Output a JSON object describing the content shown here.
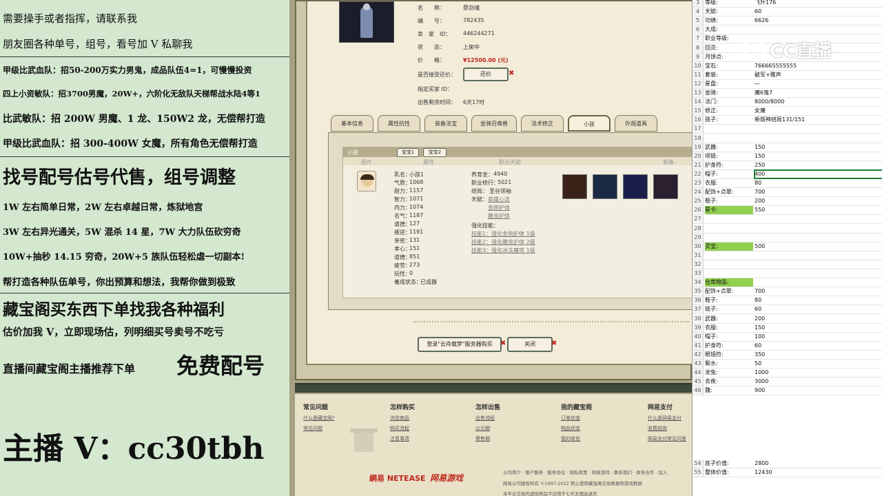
{
  "left_overlay": {
    "lines": [
      "需要操手或者指挥，请联系我",
      "朋友圈各种单号，组号，看号加 V 私聊我",
      "甲级比武血队：招50-200万实力男鬼，成品队伍4=1，可慢慢投资",
      "四上小资敏队：招3700男魔，20W+，六阶化无敌队天梯帮战水陆4等1",
      "比武敏队：招 200W 男魔、1 龙、150W2 龙，无偿帮打造",
      "甲级比武血队：招 300-400W 女魔，所有角色无偿帮打造",
      "找号配号估号代售，组号调整",
      "1W 左右简单日常，2W 左右卓越日常，炼狱地宫",
      "3W 左右异光通关，5W 混杀 14 星，7W 大力队伍砍穷奇",
      "10W+抽秒 14.15 穷奇，20W+5 族队伍轻松虐一切副本!",
      "帮打造各种队伍单号，你出预算和想法，我帮你做到极致",
      "藏宝阁买东西下单找我各种福利",
      "估价加我 V，立即现场估，列明细买号卖号不吃亏",
      "直播间藏宝阁主播推荐下单",
      "免费配号",
      "主播 V：cc30tbh"
    ]
  },
  "listing": {
    "name_label": "名　　称：",
    "name_value": "祭剑魂",
    "id_label": "编　　号：",
    "id_value": "782435",
    "seller_label": "卖　家　ID：",
    "seller_value": "446244271",
    "status_label": "状　　态：",
    "status_value": "上架中",
    "price_label": "价　　格：",
    "price_value": "¥12500.00 (元)",
    "bargain_label": "是否接受还价：",
    "bargain_button": "还价",
    "buyer_label": "指定买家 ID：",
    "remaining_label": "出售剩余时间：",
    "remaining_value": "6天17时"
  },
  "tabs": [
    "基本信息",
    "属性抗性",
    "装备法宝",
    "坐骑召唤兽",
    "法术修正",
    "小孩",
    "外观道具"
  ],
  "child_panel": {
    "title": "小孩",
    "subtabs": [
      "宝宝1",
      "宝宝2"
    ],
    "columns": [
      "图片",
      "属性",
      "职业天赋",
      "装备"
    ],
    "stats": [
      [
        "乳名：",
        "小孩1"
      ],
      [
        "气质：",
        "1068"
      ],
      [
        "耐力：",
        "1157"
      ],
      [
        "智力：",
        "1071"
      ],
      [
        "内力：",
        "1074"
      ],
      [
        "名气：",
        "1187"
      ],
      [
        "道德：",
        "127"
      ],
      [
        "叛逆：",
        "1191"
      ],
      [
        "亲密：",
        "131"
      ],
      [
        "孝心：",
        "151"
      ],
      [
        "道德：",
        "851"
      ],
      [
        "疲劳：",
        "273"
      ],
      [
        "玩性：",
        "0"
      ],
      [
        "養成状态：",
        "已成器"
      ]
    ],
    "career": [
      [
        "养育金：",
        "4940"
      ],
      [
        "职业修行：",
        "5021"
      ],
      [
        "结局：",
        "圣谷领袖"
      ]
    ],
    "talent_label": "天赋：",
    "talents": [
      "英雄心法",
      "金刚护体",
      "雕虫护体"
    ],
    "skill_label": "强化技能：",
    "skills": [
      "技能1：强化金刚护体 1级",
      "技能2：强化雕虫护体 2级",
      "技能3：强化冰冻魔攻 1级"
    ]
  },
  "buttons": {
    "login_buy": "登录\"云舟载梦\"服务器购买",
    "close": "关闭"
  },
  "footer": {
    "columns": [
      {
        "title": "常见问题",
        "links": [
          "什么是藏宝阁?",
          "常见问题"
        ]
      },
      {
        "title": "怎样购买",
        "links": [
          "浏览商品",
          "购买流程",
          "注意事项"
        ]
      },
      {
        "title": "怎样出售",
        "links": [
          "出售流程",
          "公示期",
          "寄售期"
        ]
      },
      {
        "title": "我的藏宝阁",
        "links": [
          "订单状态",
          "物品状态",
          "我的收包"
        ]
      },
      {
        "title": "网易支付",
        "links": [
          "什么是网易支付",
          "收费规则",
          "网易支付常见问答"
        ]
      }
    ],
    "brand_netease": "網易 NETEASE",
    "brand_games": "网易游戏",
    "copy1": "公司简介 · 客户服务 · 服务协议 · 隐私政策 · 网易游戏 · 联系我们 · 商务合作 · 加入",
    "copy2": "网易公司版权所有 ©1997-2022 禁止使用藏宝阁交易数据和游戏数据",
    "copy3": "本平台交易的虚拟物品不适用于七天无理由退货"
  },
  "sheet": {
    "rows": [
      [
        "3",
        "等级:",
        "飞升176"
      ],
      [
        "4",
        "天赋:",
        "60"
      ],
      [
        "5",
        "功绩:",
        "6626"
      ],
      [
        "6",
        "大成:",
        ""
      ],
      [
        "7",
        "职业等级:",
        ""
      ],
      [
        "8",
        "回灵:",
        ""
      ],
      [
        "9",
        "月饼点:",
        ""
      ],
      [
        "10",
        "宝石:",
        "766665555555"
      ],
      [
        "11",
        "套装:",
        "破军+雅声"
      ],
      [
        "12",
        "星盘:",
        "—"
      ],
      [
        "13",
        "坐骑:",
        "魔6鬼7"
      ],
      [
        "14",
        "法门:",
        "8000/8000"
      ],
      [
        "15",
        "修正:",
        "女魔"
      ],
      [
        "16",
        "孩子:",
        "新版神结局131/151"
      ],
      [
        "17",
        "",
        ""
      ],
      [
        "18",
        "",
        ""
      ],
      [
        "19",
        "武器:",
        "150"
      ],
      [
        "20",
        "项链:",
        "150"
      ],
      [
        "21",
        "护身符:",
        "250"
      ],
      [
        "22",
        "帽子:",
        "400"
      ],
      [
        "23",
        "衣服:",
        "80"
      ],
      [
        "24",
        "配饰+点翠:",
        "700"
      ],
      [
        "25",
        "鞋子:",
        "200"
      ],
      [
        "26",
        "星卡:",
        "550"
      ],
      [
        "27",
        "",
        ""
      ],
      [
        "28",
        "",
        ""
      ],
      [
        "29",
        "",
        ""
      ],
      [
        "30",
        "灵宝:",
        "500"
      ],
      [
        "31",
        "",
        ""
      ],
      [
        "32",
        "",
        ""
      ],
      [
        "33",
        "",
        ""
      ],
      [
        "34",
        "仓库物品:",
        ""
      ],
      [
        "35",
        "配饰+点翠:",
        "700"
      ],
      [
        "36",
        "鞋子:",
        "80"
      ],
      [
        "37",
        "链子:",
        "60"
      ],
      [
        "38",
        "武器:",
        "200"
      ],
      [
        "39",
        "衣服:",
        "150"
      ],
      [
        "40",
        "帽子:",
        "100"
      ],
      [
        "41",
        "护身符:",
        "60"
      ],
      [
        "42",
        "眼镜符:",
        "350"
      ],
      [
        "43",
        "鬓水:",
        "50"
      ],
      [
        "44",
        "龙兔:",
        "1000"
      ],
      [
        "45",
        "去疾:",
        "3000"
      ],
      [
        "46",
        "魏:",
        "900"
      ]
    ],
    "bottom_rows": [
      [
        "54",
        "底子价值:",
        "2800"
      ],
      [
        "55",
        "整体价值:",
        "12430"
      ]
    ],
    "watermark": "CC直播"
  }
}
